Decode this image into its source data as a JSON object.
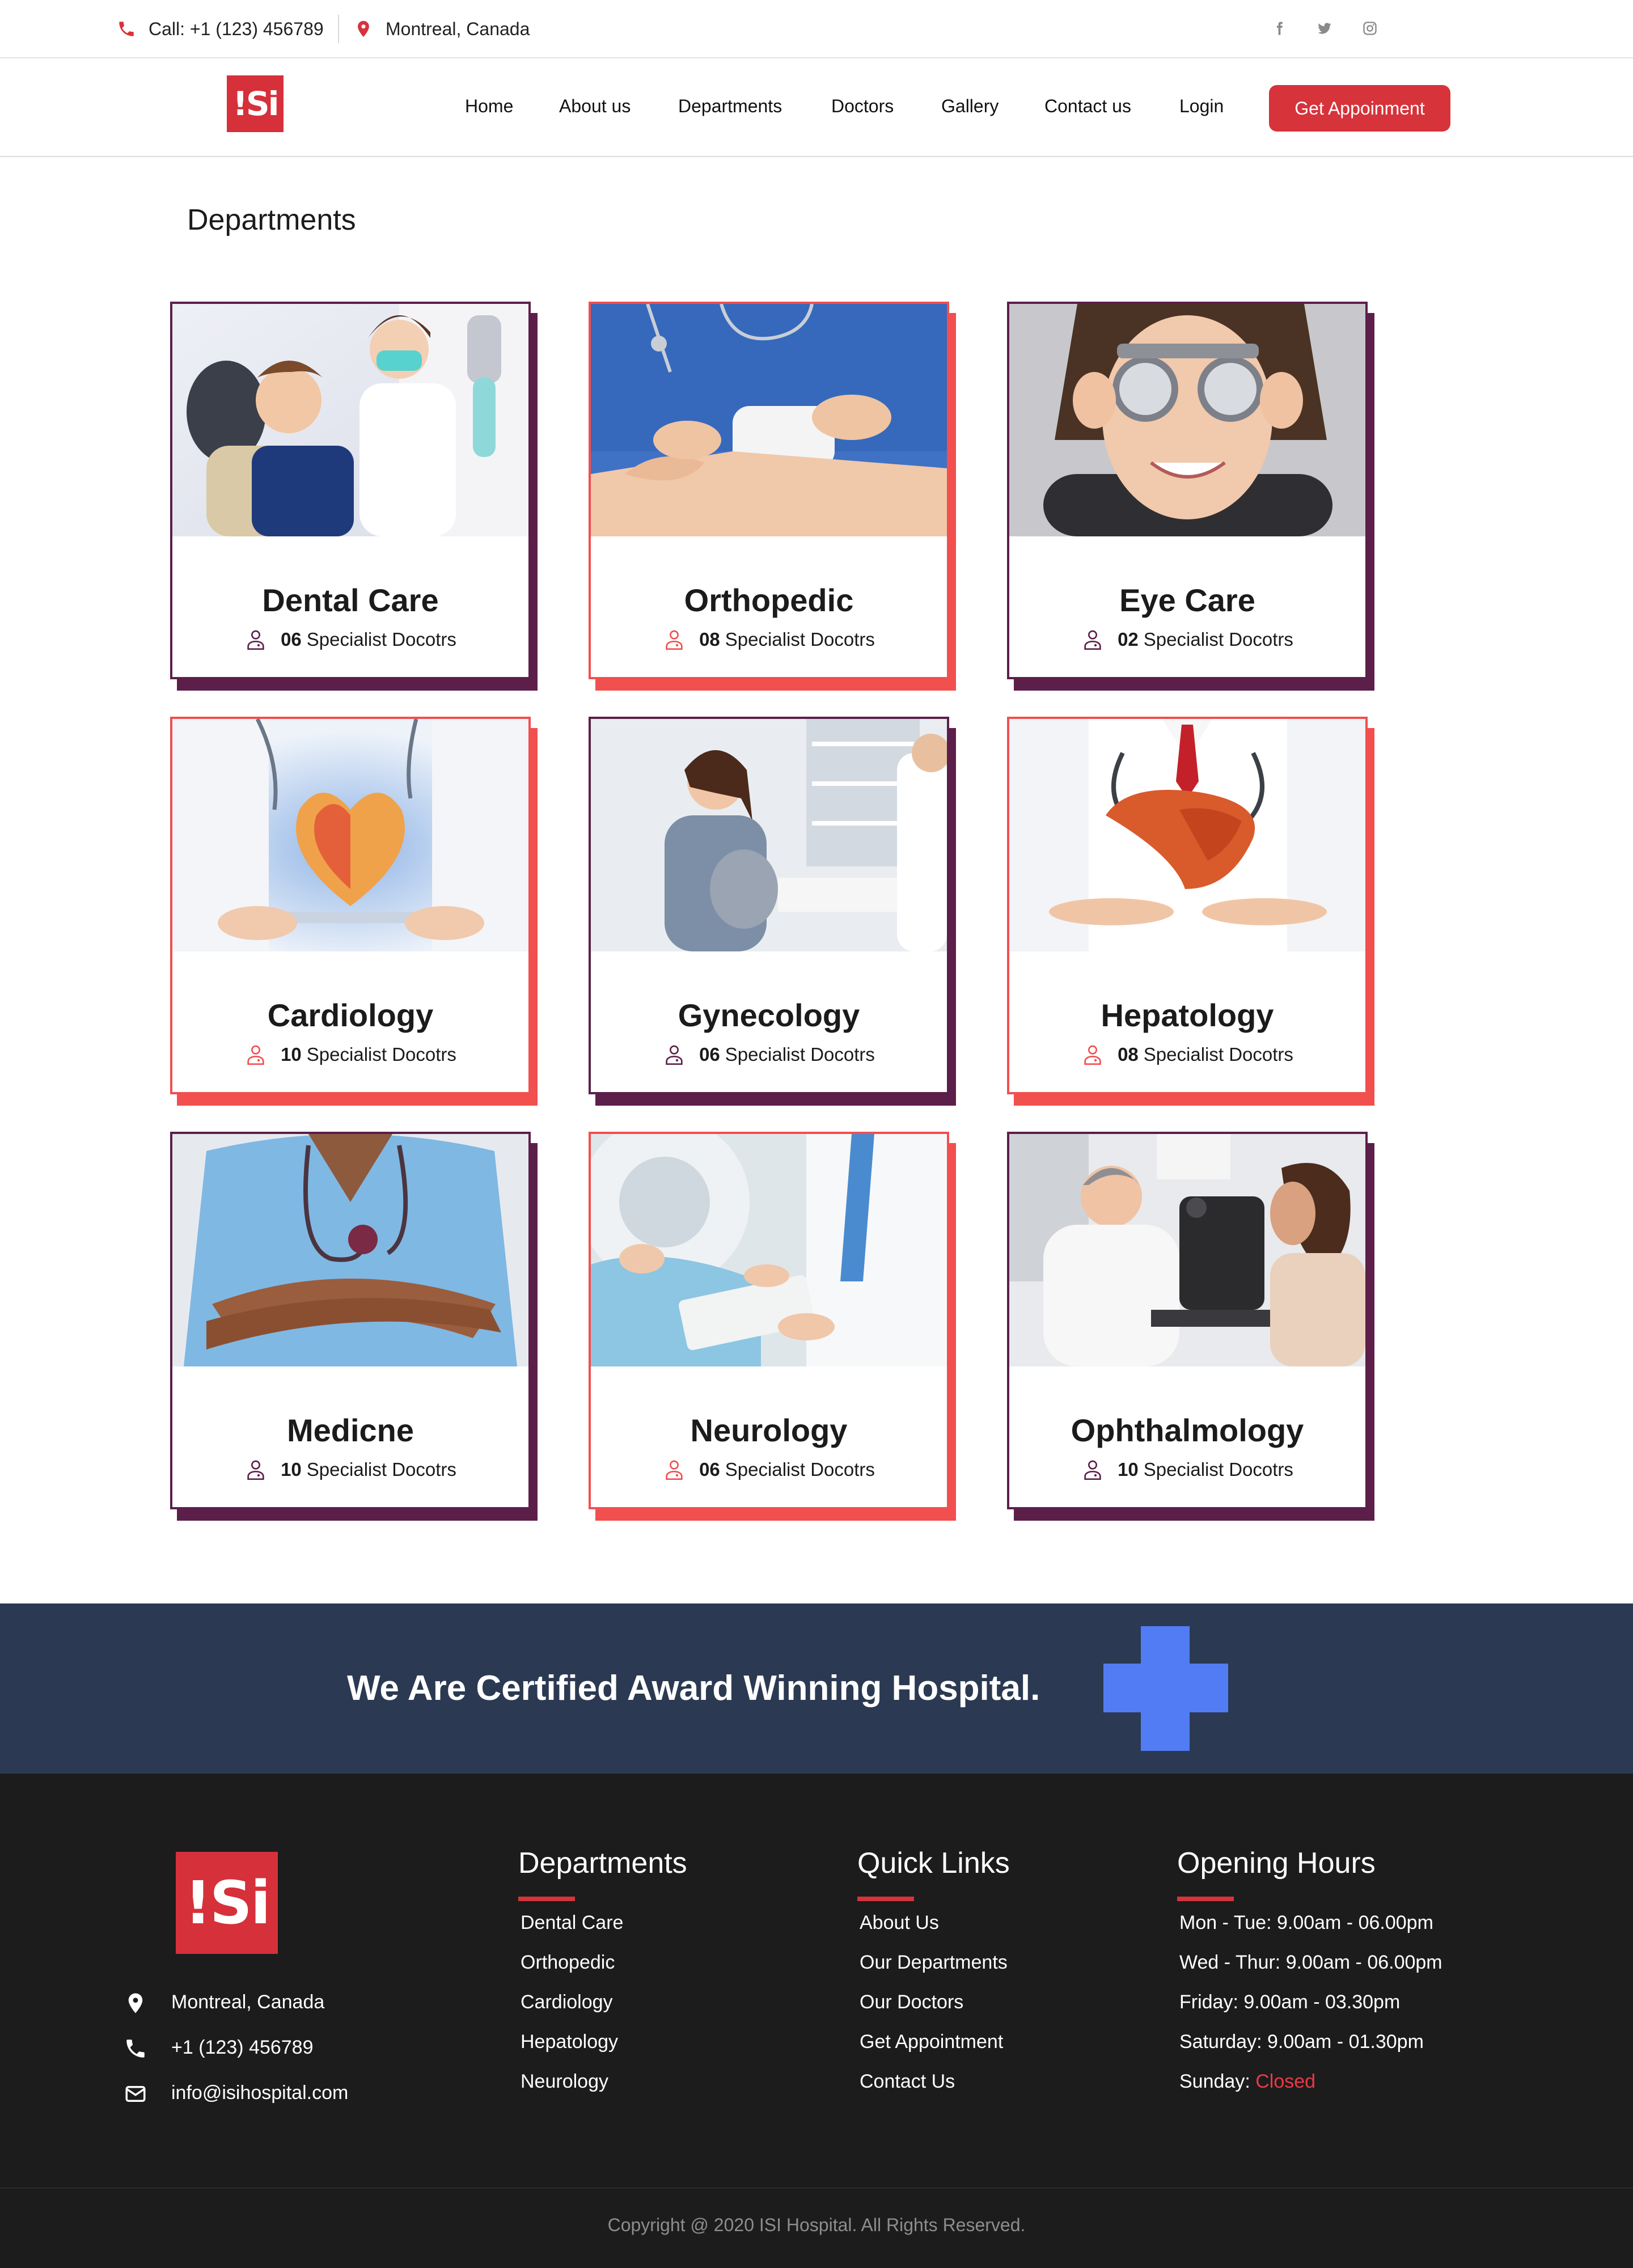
{
  "topbar": {
    "phone": "Call: +1 (123) 456789",
    "location": "Montreal, Canada",
    "social": [
      "facebook-icon",
      "twitter-icon",
      "instagram-icon"
    ]
  },
  "brand": {
    "logo_text": "!Si",
    "color": "#d6303a"
  },
  "nav": {
    "items": [
      "Home",
      "About us",
      "Departments",
      "Doctors",
      "Gallery",
      "Contact us",
      "Login"
    ],
    "cta": "Get Appoinment"
  },
  "page": {
    "title": "Departments"
  },
  "departments": [
    {
      "name": "Dental Care",
      "count": "06",
      "suffix": "Specialist Docotrs",
      "accent": "#5c1f4a"
    },
    {
      "name": "Orthopedic",
      "count": "08",
      "suffix": "Specialist Docotrs",
      "accent": "#f24f4f"
    },
    {
      "name": "Eye Care",
      "count": "02",
      "suffix": "Specialist Docotrs",
      "accent": "#5c1f4a"
    },
    {
      "name": "Cardiology",
      "count": "10",
      "suffix": "Specialist Docotrs",
      "accent": "#f24f4f"
    },
    {
      "name": "Gynecology",
      "count": "06",
      "suffix": "Specialist Docotrs",
      "accent": "#5c1f4a"
    },
    {
      "name": "Hepatology",
      "count": "08",
      "suffix": "Specialist Docotrs",
      "accent": "#f24f4f"
    },
    {
      "name": "Medicne",
      "count": "10",
      "suffix": "Specialist Docotrs",
      "accent": "#5c1f4a"
    },
    {
      "name": "Neurology",
      "count": "06",
      "suffix": "Specialist Docotrs",
      "accent": "#f24f4f"
    },
    {
      "name": "Ophthalmology",
      "count": "10",
      "suffix": "Specialist Docotrs",
      "accent": "#5c1f4a"
    }
  ],
  "award": {
    "text": "We Are Certified Award Winning Hospital."
  },
  "footer": {
    "contact": {
      "location": "Montreal, Canada",
      "phone": "+1 (123) 456789",
      "email": "info@isihospital.com"
    },
    "departments": {
      "title": "Departments",
      "items": [
        "Dental Care",
        "Orthopedic",
        "Cardiology",
        "Hepatology",
        "Neurology"
      ]
    },
    "quick_links": {
      "title": "Quick Links",
      "items": [
        "About Us",
        "Our Departments",
        "Our Doctors",
        "Get Appointment",
        "Contact Us"
      ]
    },
    "hours": {
      "title": "Opening Hours",
      "items": [
        "Mon - Tue: 9.00am - 06.00pm",
        "Wed - Thur: 9.00am - 06.00pm",
        "Friday: 9.00am - 03.30pm",
        "Saturday: 9.00am - 01.30pm"
      ],
      "sunday_label": "Sunday:",
      "sunday_value": "Closed"
    },
    "copyright": "Copyright @ 2020 ISI Hospital. All Rights Reserved."
  }
}
